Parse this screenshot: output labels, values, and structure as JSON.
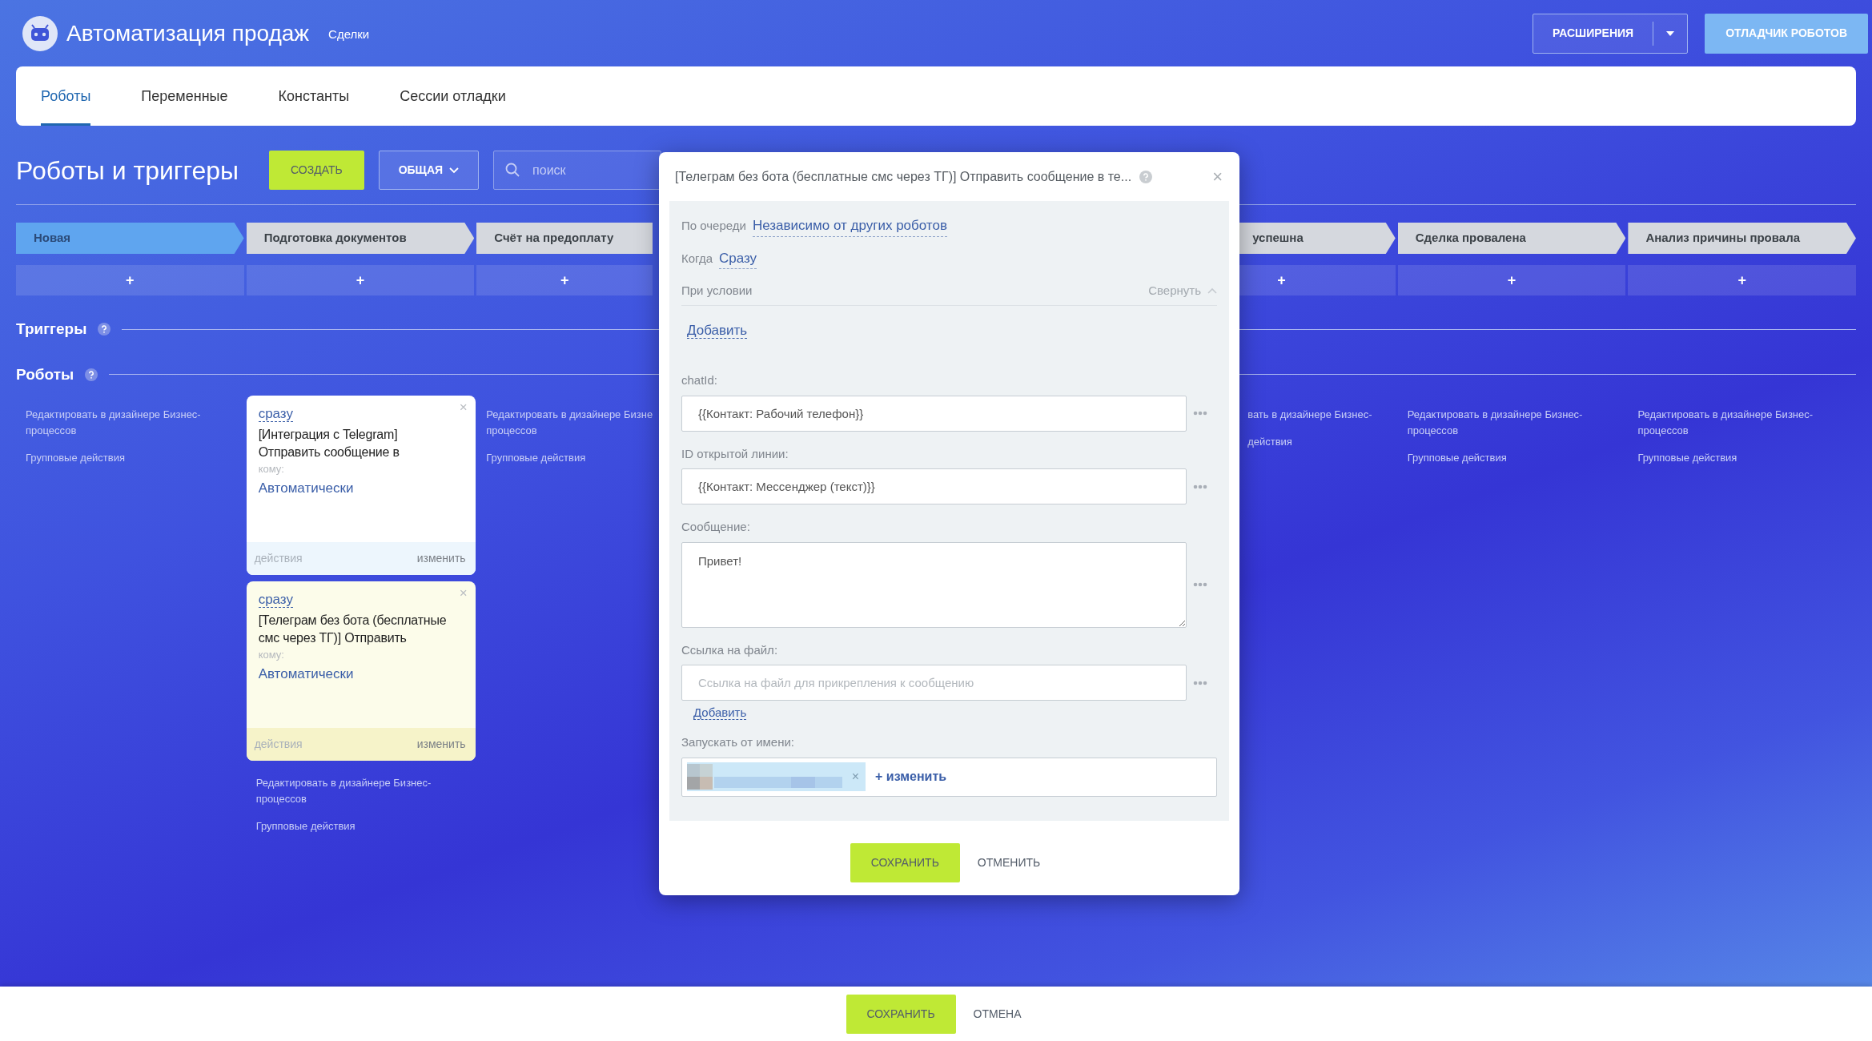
{
  "header": {
    "title": "Автоматизация продаж",
    "subtitle": "Сделки",
    "buttons": [
      {
        "label": "РАСШИРЕНИЯ",
        "kind": "split"
      },
      {
        "label": "ОТЛАДЧИК РОБОТОВ",
        "kind": "primary"
      }
    ]
  },
  "tabs": [
    {
      "label": "Роботы",
      "selected": true
    },
    {
      "label": "Переменные",
      "selected": false
    },
    {
      "label": "Константы",
      "selected": false
    },
    {
      "label": "Сессии отладки",
      "selected": false
    }
  ],
  "toolbar": {
    "title": "Роботы и триггеры",
    "create": "СОЗДАТЬ",
    "filter": "ОБЩАЯ",
    "search": {
      "placeholder": "поиск"
    }
  },
  "stages": [
    {
      "kind": "full",
      "label": "Новая",
      "selected": true,
      "add": "+"
    },
    {
      "kind": "full",
      "label": "Подготовка документов",
      "selected": false,
      "add": "+"
    },
    {
      "kind": "cut_right",
      "label": "Счёт на предоплату",
      "selected": false,
      "add": "+"
    },
    {
      "kind": "covered"
    },
    {
      "kind": "covered"
    },
    {
      "kind": "cut",
      "label": "успешна",
      "selected": false,
      "add": "+"
    },
    {
      "kind": "full",
      "label": "Сделка провалена",
      "selected": false,
      "add": "+"
    },
    {
      "kind": "full",
      "label": "Анализ причины провала",
      "selected": false,
      "add": "+"
    }
  ],
  "sections": [
    {
      "title": "Триггеры"
    },
    {
      "title": "Роботы"
    }
  ],
  "columns": [
    {
      "kind": "full",
      "links": [
        [
          "Редактировать в дизайнере Бизнес-",
          "процессов"
        ],
        [
          "Групповые действия"
        ]
      ]
    },
    {
      "kind": "full",
      "robots": [
        {
          "delay": "сразу",
          "title": "[Интеграция с Telegram] Отправить сообщение в",
          "to_label": "кому:",
          "to": "Автоматически",
          "actions": "действия",
          "edit": "изменить",
          "close": "×",
          "highlighted": false
        },
        {
          "delay": "сразу",
          "title": "[Телеграм без бота (бесплатные смс через ТГ)] Отправить",
          "to_label": "кому:",
          "to": "Автоматически",
          "actions": "действия",
          "edit": "изменить",
          "close": "×",
          "highlighted": true
        }
      ],
      "links": [
        [
          "Редактировать в дизайнере Бизнес-",
          "процессов"
        ],
        [
          "Групповые действия"
        ]
      ]
    },
    {
      "kind": "cut_right",
      "links": [
        [
          "Редактировать в дизайнере Бизне",
          "процессов"
        ],
        [
          "Групповые действия"
        ]
      ]
    },
    {
      "kind": "covered"
    },
    {
      "kind": "covered"
    },
    {
      "kind": "cut",
      "links": [
        [
          "вать в дизайнере Бизнес-"
        ],
        [
          "действия"
        ]
      ]
    },
    {
      "kind": "full",
      "links": [
        [
          "Редактировать в дизайнере Бизнес-",
          "процессов"
        ],
        [
          "Групповые действия"
        ]
      ]
    },
    {
      "kind": "full",
      "links": [
        [
          "Редактировать в дизайнере Бизнес-",
          "процессов"
        ],
        [
          "Групповые действия"
        ]
      ]
    }
  ],
  "dialog": {
    "title": "[Телеграм без бота (бесплатные смс через ТГ)] Отправить сообщение в те...",
    "close": "×",
    "queue": {
      "label": "По очереди",
      "value": "Независимо от других роботов"
    },
    "when": {
      "label": "Когда",
      "value": "Сразу"
    },
    "condition": {
      "label": "При условии",
      "collapse": "Свернуть",
      "add": "Добавить"
    },
    "fields": [
      {
        "kind": "input",
        "label": "chatId:",
        "value": "{{Контакт: Рабочий телефон}}"
      },
      {
        "kind": "input",
        "label": "ID открытой линии:",
        "value": "{{Контакт: Мессенджер (текст)}}"
      },
      {
        "kind": "textarea",
        "label": "Сообщение:",
        "value": "Привет!"
      },
      {
        "kind": "input",
        "label": "Ссылка на файл:",
        "placeholder": "Ссылка на файл для прикрепления к сообщению",
        "add": "Добавить"
      }
    ],
    "run_as": {
      "label": "Запускать от имени:",
      "remove": "×",
      "change": "+ изменить"
    },
    "buttons": {
      "save": "СОХРАНИТЬ",
      "cancel": "ОТМЕНИТЬ"
    }
  },
  "footer": {
    "save": "СОХРАНИТЬ",
    "cancel": "ОТМЕНА"
  }
}
